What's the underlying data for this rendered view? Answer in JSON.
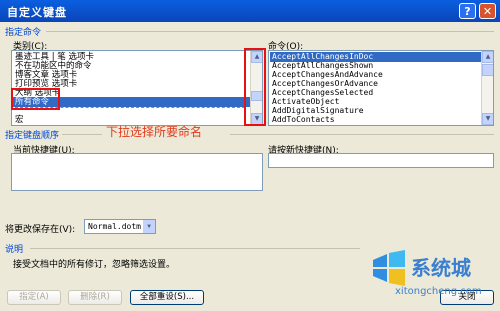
{
  "dialog": {
    "title": "自定义键盘",
    "help_glyph": "?",
    "close_glyph": "✕"
  },
  "specify_command": {
    "section_title": "指定命令",
    "categories_label": "类别(C):",
    "categories": [
      "墨迹工具 | 笔 选项卡",
      "不在功能区中的命令",
      "博客文章 选项卡",
      "打印预览 选项卡",
      "大纲 选项卡",
      "所有命令",
      "",
      "宏"
    ],
    "commands_label": "命令(O):",
    "commands": [
      "AcceptAllChangesInDoc",
      "AcceptAllChangesShown",
      "AcceptChangesAndAdvance",
      "AcceptChangesOrAdvance",
      "AcceptChangesSelected",
      "ActivateObject",
      "AddDigitalSignature",
      "AddToContacts"
    ]
  },
  "annotation": "下拉选择所要命名",
  "keyboard_sequence": {
    "section_title": "指定键盘顺序",
    "current_keys_label": "当前快捷键(U):",
    "new_key_label": "请按新快捷键(N):",
    "new_key_value": ""
  },
  "save_in": {
    "label": "将更改保存在(V):",
    "value": "Normal.dotm"
  },
  "description": {
    "section_title": "说明",
    "text": "接受文档中的所有修订，忽略筛选设置。"
  },
  "buttons": {
    "assign": "指定(A)",
    "remove": "删除(R)",
    "reset_all": "全部重设(S)...",
    "close": "关闭"
  },
  "watermark": {
    "text": "系统城",
    "url": "xitongcheng.com"
  },
  "colors": {
    "title_blue": "#0a5fe0",
    "dialog_bg": "#ece9d8",
    "selection": "#316ac5",
    "section_title": "#0046d5",
    "annotation_red": "#e81010"
  }
}
